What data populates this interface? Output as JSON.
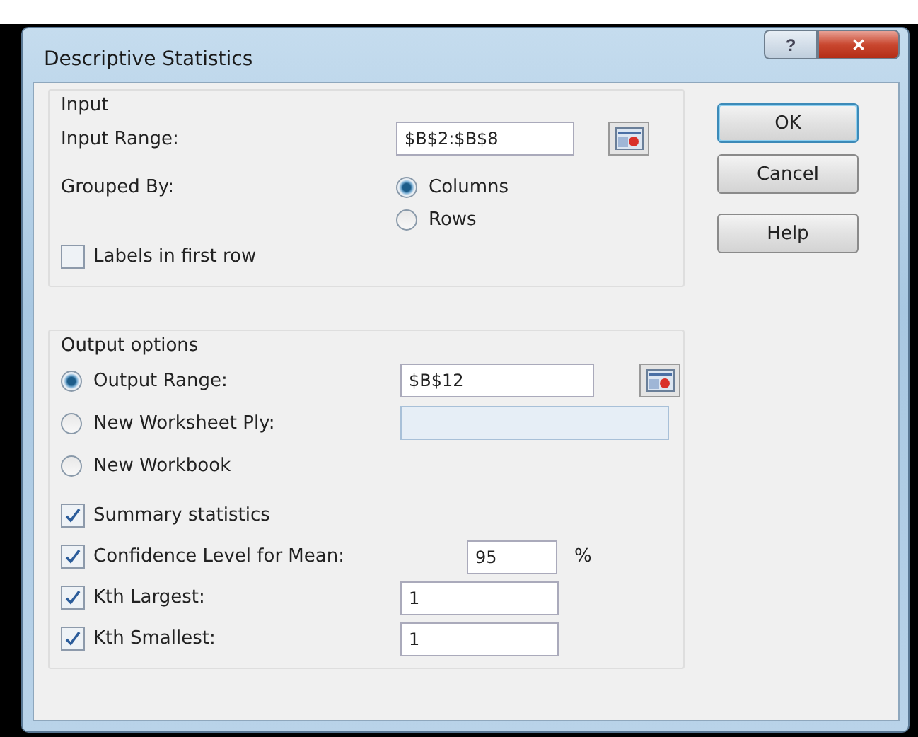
{
  "window": {
    "title": "Descriptive Statistics",
    "help_button": "?",
    "close_button": "✕"
  },
  "input": {
    "legend": "Input",
    "range_label": "Input Range:",
    "range_value": "$B$2:$B$8",
    "grouped_label": "Grouped By:",
    "grouped_options": [
      {
        "label": "Columns",
        "selected": true
      },
      {
        "label": "Rows",
        "selected": false
      }
    ],
    "labels_checkbox": {
      "label": "Labels in first row",
      "checked": false
    }
  },
  "output": {
    "legend": "Output options",
    "destinations": [
      {
        "label": "Output Range:",
        "selected": true,
        "value": "$B$12",
        "kind": "range"
      },
      {
        "label": "New Worksheet Ply:",
        "selected": false,
        "kind": "text"
      },
      {
        "label": "New Workbook",
        "selected": false,
        "kind": "none"
      }
    ],
    "options": [
      {
        "label": "Summary statistics",
        "checked": true,
        "kind": "plain"
      },
      {
        "label": "Confidence Level for Mean:",
        "checked": true,
        "kind": "percent",
        "value": "95",
        "unit": "%"
      },
      {
        "label": "Kth Largest:",
        "checked": true,
        "kind": "number",
        "value": "1"
      },
      {
        "label": "Kth Smallest:",
        "checked": true,
        "kind": "number",
        "value": "1"
      }
    ]
  },
  "buttons": [
    {
      "label": "OK",
      "default": true
    },
    {
      "label": "Cancel",
      "default": false
    },
    {
      "label": "Help",
      "default": false
    }
  ]
}
